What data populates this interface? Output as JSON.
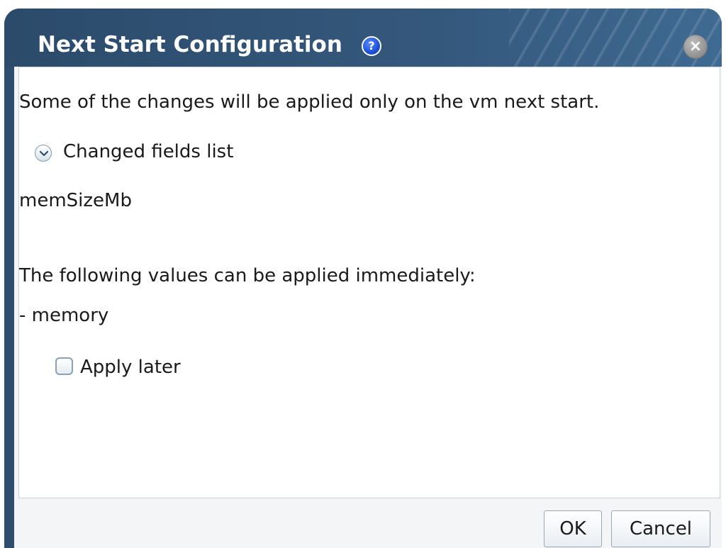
{
  "dialog": {
    "title": "Next Start Configuration",
    "help_icon": "?",
    "close_icon": "×"
  },
  "content": {
    "intro": "Some of the changes will be applied only on the vm next start.",
    "changed_fields_label": "Changed fields list",
    "changed_fields": [
      "memSizeMb"
    ],
    "immediate_title": "The following values can be applied immediately:",
    "immediate_values": [
      "- memory"
    ],
    "apply_later": {
      "label": "Apply later",
      "checked": false
    }
  },
  "buttons": {
    "ok_label": "OK",
    "cancel_label": "Cancel"
  },
  "colors": {
    "header": "#2f4e6e",
    "help_icon": "#1c4fd6"
  }
}
